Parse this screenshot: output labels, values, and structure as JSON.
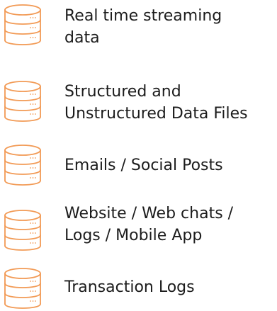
{
  "icon": {
    "name": "database-icon",
    "color": "#f29a55"
  },
  "items": [
    {
      "line1": "Real time streaming",
      "line2": "data"
    },
    {
      "line1": "Structured and",
      "line2": "Unstructured Data Files"
    },
    {
      "line1": "Emails / Social Posts",
      "line2": ""
    },
    {
      "line1": "Website / Web chats /",
      "line2": "Logs / Mobile App"
    },
    {
      "line1": "Transaction Logs",
      "line2": ""
    }
  ]
}
